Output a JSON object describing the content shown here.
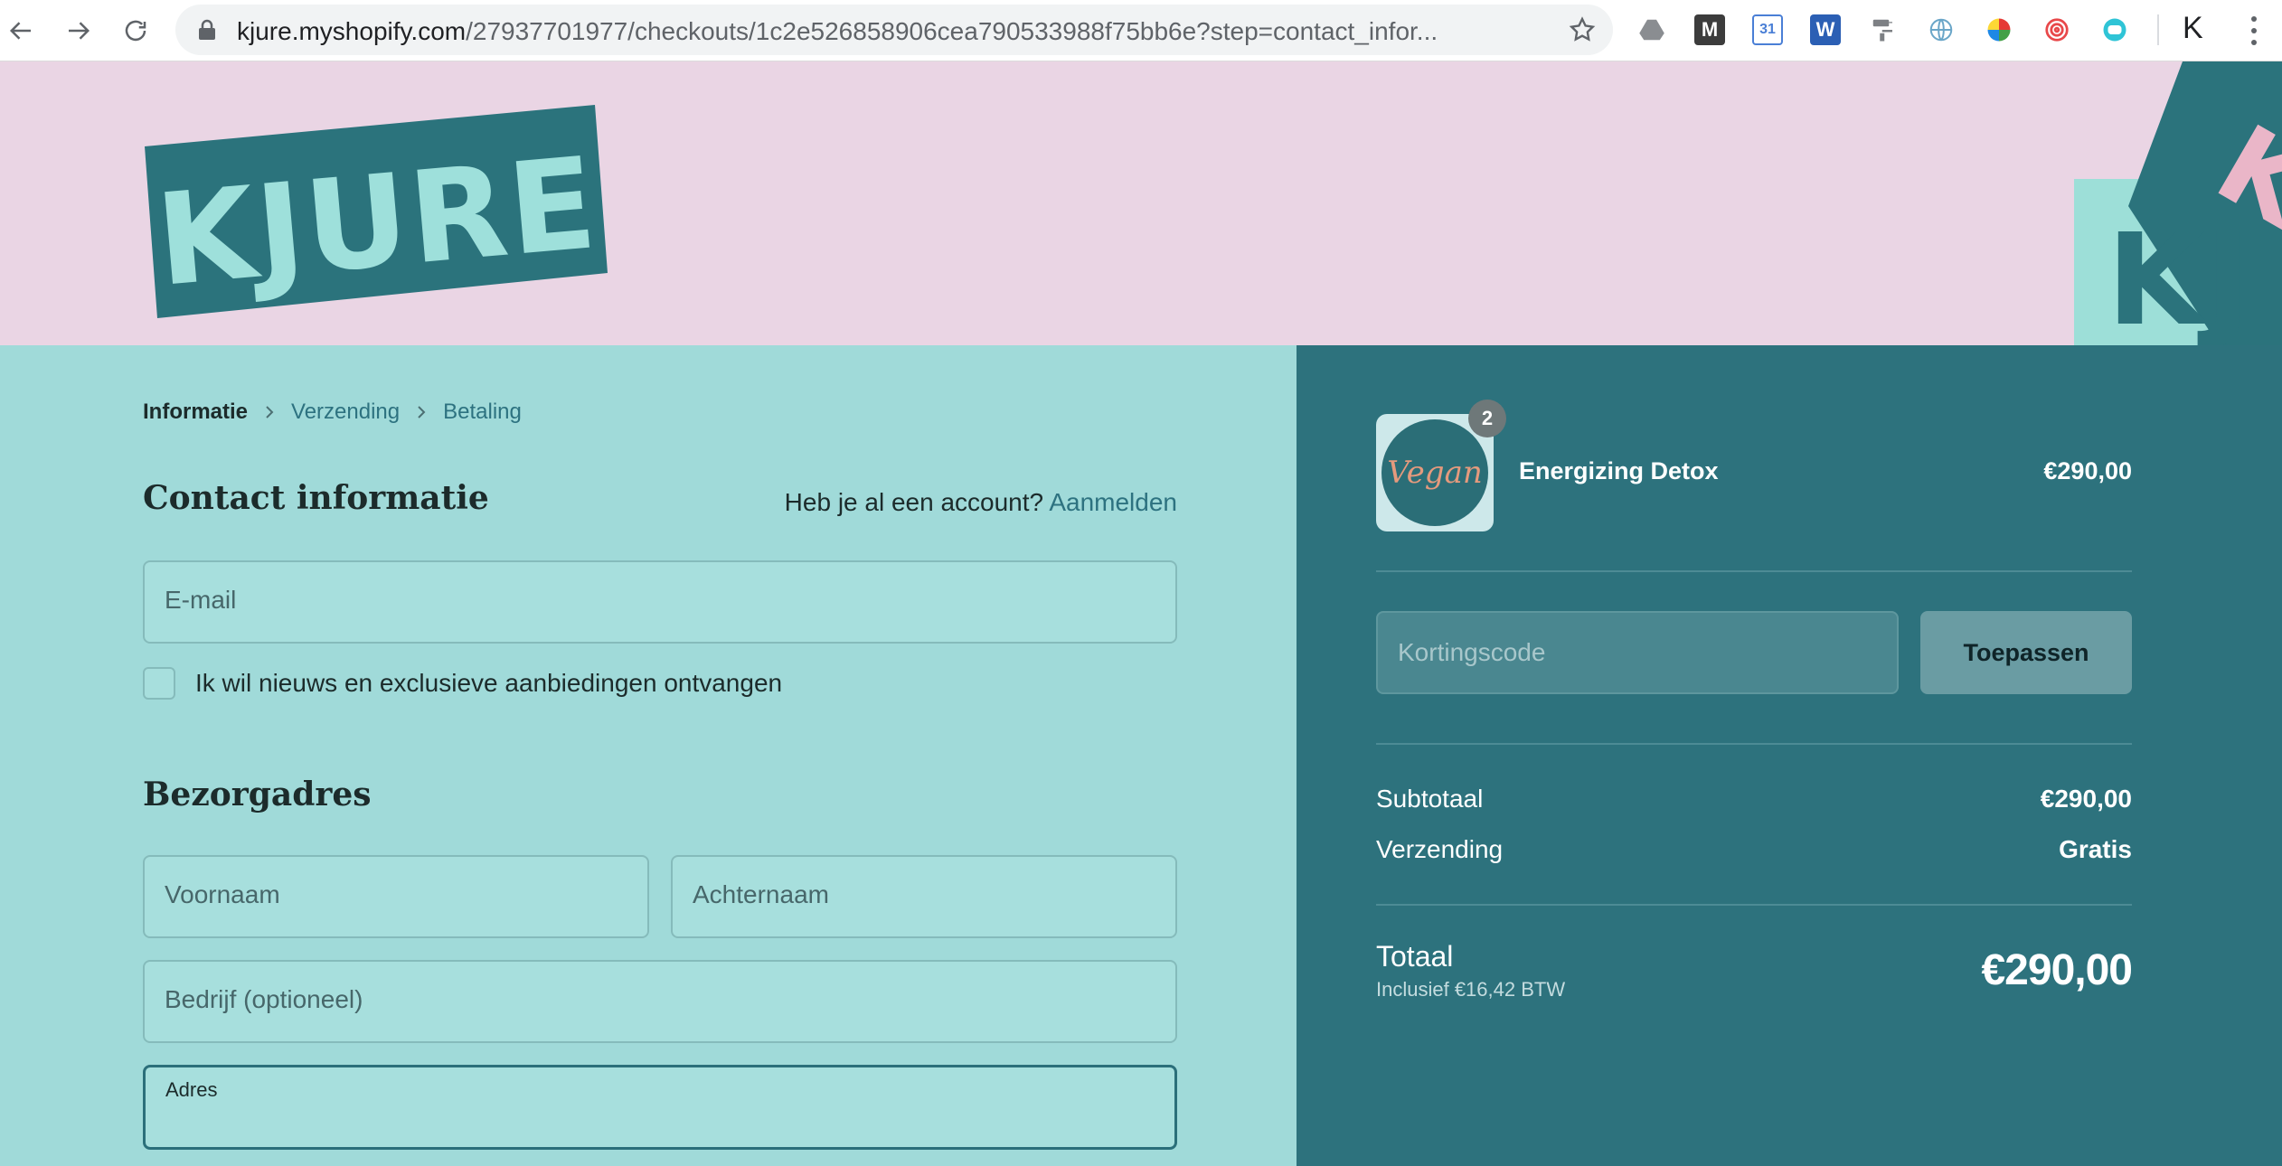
{
  "browser": {
    "url_host": "kjure.myshopify.com",
    "url_path": "/27937701977/checkouts/1c2e526858906cea790533988f75bb6e?step=contact_infor...",
    "profile_initial": "K",
    "extensions": [
      "drive-icon",
      "gmail-icon",
      "calendar-extension-icon",
      "word-icon",
      "paint-roller-icon",
      "web-extension-icon",
      "color-wheel-icon",
      "swirl-icon",
      "bot-icon"
    ]
  },
  "banner": {
    "logo_text": "KJURE",
    "colors": {
      "background": "#ead5e4",
      "logo": "#2b737c",
      "logo_text": "#9ee0db"
    }
  },
  "breadcrumb": {
    "current": "Informatie",
    "step2": "Verzending",
    "step3": "Betaling"
  },
  "contact": {
    "title": "Contact informatie",
    "account_prompt": "Heb je al een account?",
    "login_link": "Aanmelden",
    "email_placeholder": "E-mail",
    "newsletter_label": "Ik wil nieuws en exclusieve aanbiedingen ontvangen"
  },
  "shipping_address": {
    "title": "Bezorgadres",
    "first_name_placeholder": "Voornaam",
    "last_name_placeholder": "Achternaam",
    "company_placeholder": "Bedrijf (optioneel)",
    "address_label": "Adres"
  },
  "summary": {
    "product": {
      "name": "Energizing Detox",
      "price": "€290,00",
      "quantity": "2",
      "image_text": "Vegan"
    },
    "discount_placeholder": "Kortingscode",
    "apply_label": "Toepassen",
    "subtotal_label": "Subtotaal",
    "subtotal_value": "€290,00",
    "shipping_label": "Verzending",
    "shipping_value": "Gratis",
    "total_label": "Totaal",
    "tax_note": "Inclusief €16,42 BTW",
    "total_value": "€290,00"
  },
  "colors": {
    "form_background": "#a0dad9",
    "summary_background": "#2d727d",
    "link": "#2d7280"
  }
}
